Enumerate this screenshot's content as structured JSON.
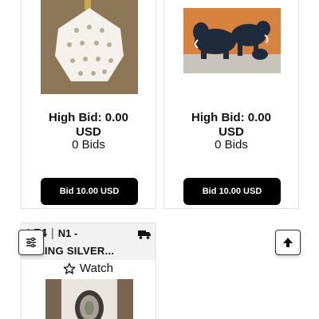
{
  "items": [
    {
      "image_icon": "pierced-ceramic-lamp-image",
      "bid_line1": "High Bid: 0.00",
      "bid_line2": "USD",
      "bid_count": "0 Bids",
      "bid_button": "Bid 10.00 USD"
    },
    {
      "image_icon": "carved-elephant-figurines-image",
      "bid_line1": "High Bid: 0.00",
      "bid_line2": "USD",
      "bid_count": "0 Bids",
      "bid_button": "Bid 10.00 USD"
    }
  ],
  "partial_item": {
    "lot_number": "t 74",
    "lot_code": "N1 -",
    "title": "ERLING SILVER...",
    "watch_label": "Watch",
    "shipping_icon": "truck-icon",
    "image_icon": "silver-item-image"
  },
  "floating": {
    "filter_icon": "sliders-icon",
    "top_icon": "arrow-up-icon"
  }
}
